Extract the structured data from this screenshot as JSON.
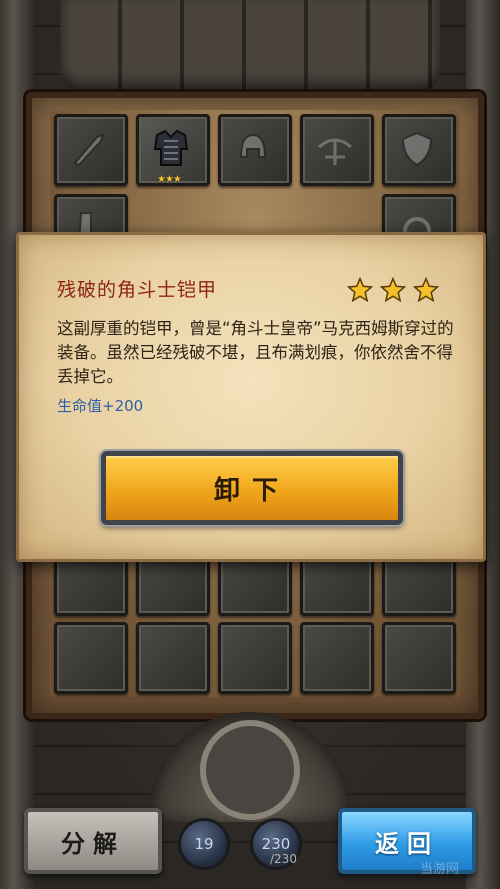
{
  "item": {
    "name": "残破的角斗士铠甲",
    "rating": 3,
    "description": "这副厚重的铠甲，曾是“角斗士皇帝”马克西姆斯穿过的装备。虽然已经残破不堪，且布满划痕，你依然舍不得丢掉它。",
    "stat": "生命值+200",
    "unequip_label": "卸下"
  },
  "inventory": {
    "equipped_stars": "★★★",
    "slot_icons": [
      "sword-icon",
      "chest-armor-icon",
      "helmet-icon",
      "crossbow-icon",
      "shield-icon",
      "boots-icon"
    ]
  },
  "bottom_bar": {
    "decompose_label": "分解",
    "back_label": "返回",
    "counter_1": "19",
    "counter_2": "230",
    "counter_2_max": "/230"
  },
  "watermark": "当游网",
  "colors": {
    "title": "#8e2414",
    "stat": "#2f5fa8",
    "star": "#f3c02c",
    "unequip_button": "#f0a61c",
    "back_button": "#2f9de6"
  }
}
